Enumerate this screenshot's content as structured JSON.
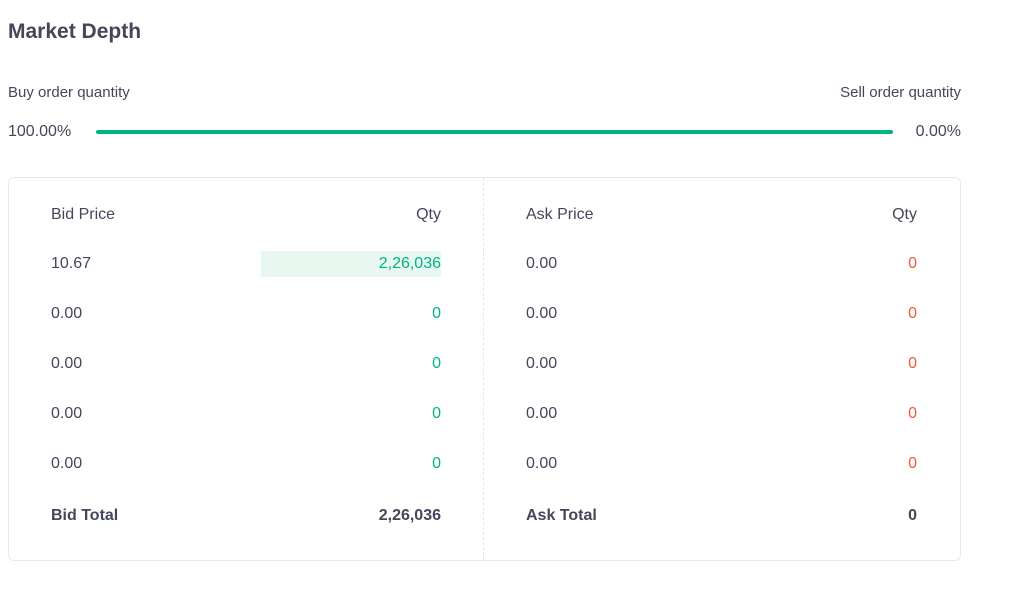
{
  "header": {
    "title": "Market Depth"
  },
  "ratio": {
    "buy_label": "Buy order quantity",
    "sell_label": "Sell order quantity",
    "buy_percent": "100.00%",
    "sell_percent": "0.00%",
    "buy_fraction": 1.0
  },
  "bids": {
    "price_header": "Bid Price",
    "qty_header": "Qty",
    "rows": [
      {
        "price": "10.67",
        "qty": "2,26,036",
        "fill_fraction": 1.0
      },
      {
        "price": "0.00",
        "qty": "0",
        "fill_fraction": 0
      },
      {
        "price": "0.00",
        "qty": "0",
        "fill_fraction": 0
      },
      {
        "price": "0.00",
        "qty": "0",
        "fill_fraction": 0
      },
      {
        "price": "0.00",
        "qty": "0",
        "fill_fraction": 0
      }
    ],
    "total_label": "Bid Total",
    "total_value": "2,26,036"
  },
  "asks": {
    "price_header": "Ask Price",
    "qty_header": "Qty",
    "rows": [
      {
        "price": "0.00",
        "qty": "0",
        "fill_fraction": 0
      },
      {
        "price": "0.00",
        "qty": "0",
        "fill_fraction": 0
      },
      {
        "price": "0.00",
        "qty": "0",
        "fill_fraction": 0
      },
      {
        "price": "0.00",
        "qty": "0",
        "fill_fraction": 0
      },
      {
        "price": "0.00",
        "qty": "0",
        "fill_fraction": 0
      }
    ],
    "total_label": "Ask Total",
    "total_value": "0"
  },
  "colors": {
    "buy": "#00b386",
    "sell": "#eb5b3c",
    "buy_fill": "#e9f7f1",
    "text": "#44475b"
  }
}
